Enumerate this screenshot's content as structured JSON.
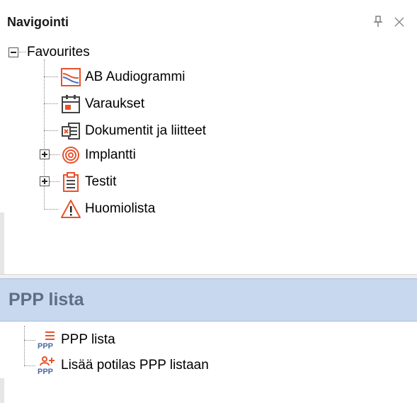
{
  "navigation": {
    "title": "Navigointi",
    "tree": {
      "root_label": "Favourites",
      "items": [
        {
          "label": "AB Audiogrammi",
          "icon": "audiogram-icon"
        },
        {
          "label": "Varaukset",
          "icon": "calendar-icon"
        },
        {
          "label": "Dokumentit ja liitteet",
          "icon": "document-icon"
        },
        {
          "label": "Implantti",
          "icon": "implant-spiral-icon",
          "expandable": true
        },
        {
          "label": "Testit",
          "icon": "clipboard-icon",
          "expandable": true
        },
        {
          "label": "Huomiolista",
          "icon": "warning-icon"
        }
      ]
    }
  },
  "ppp": {
    "title": "PPP lista",
    "items": [
      {
        "label": "PPP lista",
        "icon": "ppp-list-icon"
      },
      {
        "label": "Lisää potilas PPP listaan",
        "icon": "ppp-add-patient-icon"
      }
    ]
  },
  "colors": {
    "accent": "#e8522b",
    "header_bg": "#c7d8ef",
    "header_text": "#5e6e83"
  }
}
